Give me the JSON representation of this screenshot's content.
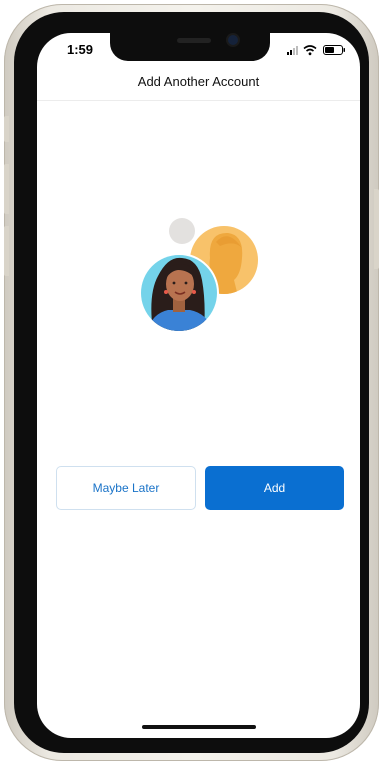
{
  "status_bar": {
    "time": "1:59",
    "icons": [
      "cellular-signal-icon",
      "wifi-icon",
      "battery-icon"
    ]
  },
  "header": {
    "title": "Add Another Account"
  },
  "illustration": {
    "icon": "add-account-avatars-icon",
    "colors": {
      "front_circle": "#74d3ea",
      "back_circle": "#f8c26a",
      "small_dot": "#e3e1df"
    }
  },
  "actions": {
    "secondary_label": "Maybe Later",
    "primary_label": "Add"
  },
  "colors": {
    "accent": "#0a6fd1",
    "secondary_text": "#1a73c8",
    "background": "#ffffff"
  }
}
